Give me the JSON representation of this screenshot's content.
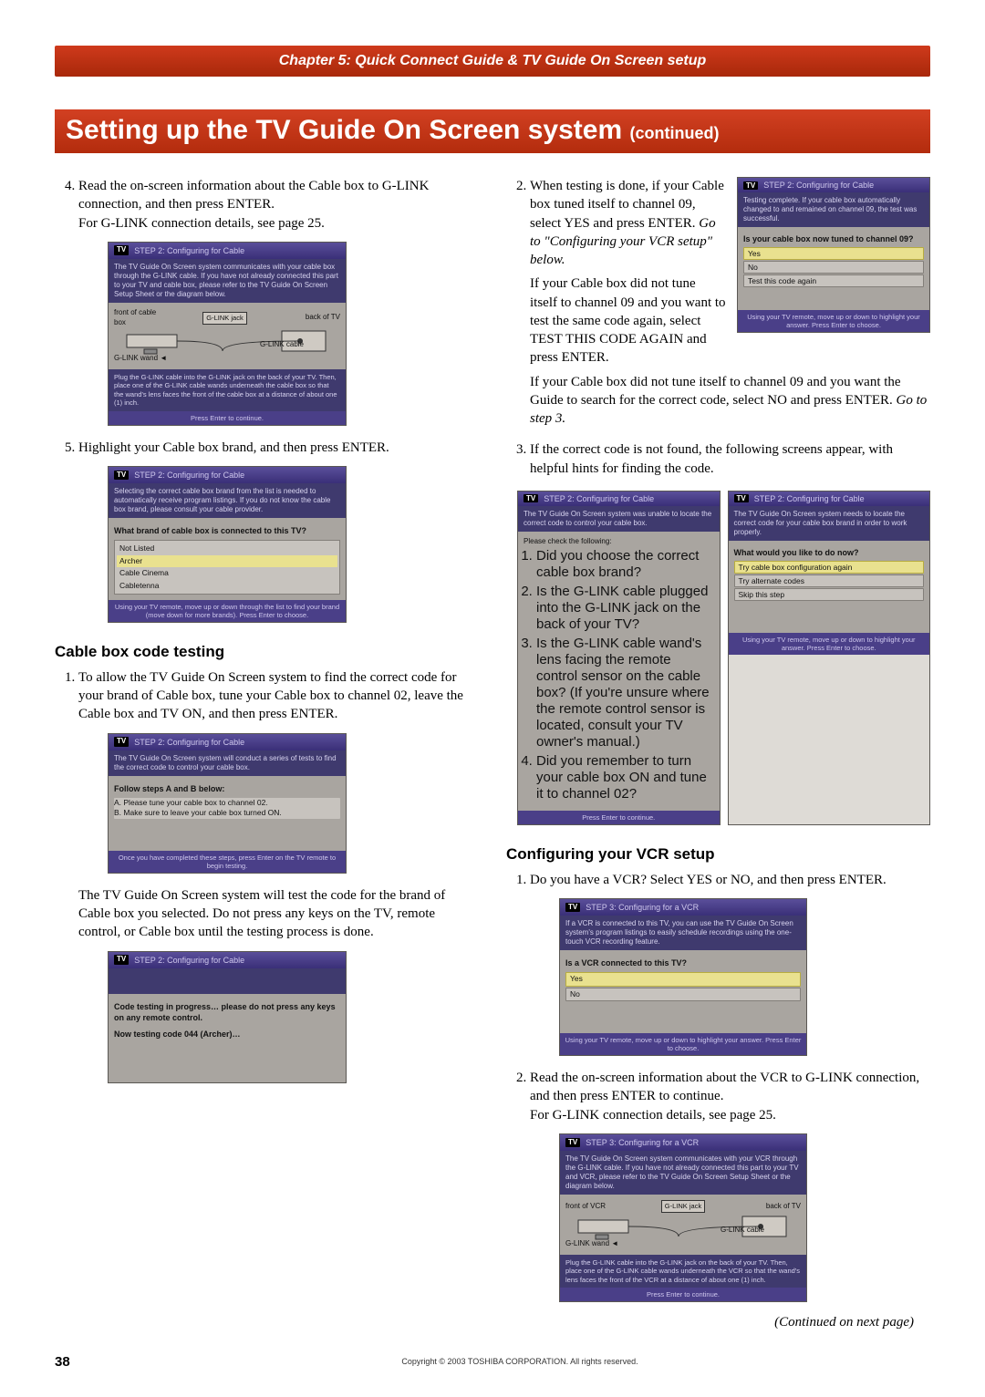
{
  "chapter_band": "Chapter 5: Quick Connect Guide & TV Guide On Screen setup",
  "page_title_main": "Setting up the TV Guide On Screen system ",
  "page_title_sub": "(continued)",
  "left": {
    "step4": "Read the on-screen information about the Cable box to G-LINK connection, and then press ENTER.",
    "step4_b": "For G-LINK connection details, see page 25.",
    "ui1": {
      "title": "STEP 2: Configuring for Cable",
      "top": "The TV Guide On Screen system communicates with your cable box through the G-LINK cable. If you have not already connected this part to your TV and cable box, please refer to the TV Guide On Screen Setup Sheet or the diagram below.",
      "diag_front": "front of cable box",
      "diag_jack": "G-LINK jack",
      "diag_back": "back of TV",
      "diag_cable": "G-LINK cable",
      "diag_wand": "G-LINK wand",
      "diag_note": "Plug the G-LINK cable into the G-LINK jack on the back of your TV. Then, place one of the G-LINK cable wands underneath the cable box so that the wand's lens faces the front of the cable box at a distance of about one (1) inch.",
      "foot": "Press Enter to continue."
    },
    "step5": "Highlight your Cable box brand, and then press ENTER.",
    "ui2": {
      "title": "STEP 2: Configuring for Cable",
      "top": "Selecting the correct cable box brand from the list is needed to automatically receive program listings. If you do not know the cable box brand, please consult your cable provider.",
      "q": "What brand of cable box is connected to this TV?",
      "opts": [
        "Not Listed",
        "Archer",
        "Cable Cinema",
        "Cabletenna"
      ],
      "sel": 1,
      "foot": "Using your TV remote, move up or down through the list to find your brand (move down for more brands). Press Enter to choose."
    },
    "section_a": "Cable box code testing",
    "a_step1": "To allow the TV Guide On Screen system to find the correct code for your brand of Cable box, tune your Cable box to channel 02, leave the Cable box and TV ON, and then press ENTER.",
    "ui3": {
      "title": "STEP 2: Configuring for Cable",
      "top": "The TV Guide On Screen system will conduct a series of tests to find the correct code to control your cable box.",
      "q": "Follow steps A and B below:",
      "l1": "A.  Please tune your cable box to channel 02.",
      "l2": "B.  Make sure to leave your cable box turned ON.",
      "foot": "Once you have completed these steps, press Enter on the TV remote to begin testing."
    },
    "para_after3": "The TV Guide On Screen system will test the code for the brand of Cable box you selected. Do not press any keys on the TV, remote control, or Cable box until the testing process is done.",
    "ui4": {
      "title": "STEP 2: Configuring for Cable",
      "l1": "Code testing in progress… please do not press any keys on any remote control.",
      "l2": "Now testing code 044 (Archer)…"
    }
  },
  "right": {
    "uiR1": {
      "title": "STEP 2: Configuring for Cable",
      "top": "Testing complete. If your cable box automatically changed to and remained on channel 09, the test was successful.",
      "q": "Is your cable box now tuned to channel 09?",
      "opts": [
        "Yes",
        "No",
        "Test this code again"
      ],
      "sel": 0,
      "foot": "Using your TV remote, move up or down to highlight your answer.  Press Enter to choose."
    },
    "step2a": "When testing is done, if your Cable box tuned itself to channel 09, select YES and press ENTER.",
    "step2a_it": "Go to \"Configuring your VCR setup\" below.",
    "step2b": "If your Cable box did not tune itself to channel 09 and you want to test the same code again, select TEST THIS CODE AGAIN and press ENTER.",
    "step2c_a": "If your Cable box did not tune itself to channel 09 and you want the Guide to search for the correct code, select NO and press ENTER. ",
    "step2c_b": "Go to step 3.",
    "step3": "If the correct code is not found, the following screens appear, with helpful hints for finding the code.",
    "uiR2a": {
      "title": "STEP 2: Configuring for Cable",
      "top": "The TV Guide On Screen system was unable to locate the correct code to control your cable box.",
      "sub": "Please check the following:",
      "items": [
        "Did you choose the correct cable box brand?",
        "Is the G-LINK cable plugged into the G-LINK jack on the back of your TV?",
        "Is the G-LINK cable wand's lens facing the remote control sensor on the cable box? (If you're unsure where the remote control sensor is located, consult your TV owner's manual.)",
        "Did you remember to turn your cable box ON and tune it to channel 02?"
      ],
      "foot": "Press Enter to continue."
    },
    "uiR2b": {
      "title": "STEP 2: Configuring for Cable",
      "top": "The TV Guide On Screen system needs to locate the correct code for your cable box brand in order to work properly.",
      "q": "What would you like to do now?",
      "opts": [
        "Try cable box configuration again",
        "Try alternate codes",
        "Skip this step"
      ],
      "sel": 0,
      "foot": "Using your TV remote, move up or down to highlight your answer.  Press Enter to choose."
    },
    "section_b": "Configuring your VCR setup",
    "b_step1": "Do you have a VCR? Select YES or NO, and then press ENTER.",
    "uiR3": {
      "title": "STEP 3: Configuring for a VCR",
      "top": "If a VCR is connected to this TV, you can use the TV Guide On Screen system's program listings to easily schedule recordings using the one-touch VCR recording feature.",
      "q": "Is a VCR connected to this TV?",
      "opts": [
        "Yes",
        "No"
      ],
      "sel": 0,
      "foot": "Using your TV remote, move up or down to highlight your answer.  Press Enter to choose."
    },
    "b_step2": "Read the on-screen information about the VCR to G-LINK connection, and then press ENTER to continue.",
    "b_step2b": "For G-LINK connection details, see page 25.",
    "uiR4": {
      "title": "STEP 3: Configuring for a VCR",
      "top": "The TV Guide On Screen system communicates with your VCR through the G-LINK cable. If you have not already connected this part to your TV and VCR, please refer to the TV Guide On Screen Setup Sheet or the diagram below.",
      "diag_front": "front of VCR",
      "diag_jack": "G-LINK jack",
      "diag_back": "back of TV",
      "diag_cable": "G-LINK cable",
      "diag_wand": "G-LINK wand",
      "diag_note": "Plug the G-LINK cable into the G-LINK jack on the back of your TV. Then, place one of the G-LINK cable wands underneath the VCR so that the wand's lens faces the front of the VCR at a distance of about one (1) inch.",
      "foot": "Press Enter to continue."
    },
    "continued": "(Continued on next page)"
  },
  "footer": {
    "page": "38",
    "copyright": "Copyright © 2003 TOSHIBA CORPORATION. All rights reserved."
  }
}
